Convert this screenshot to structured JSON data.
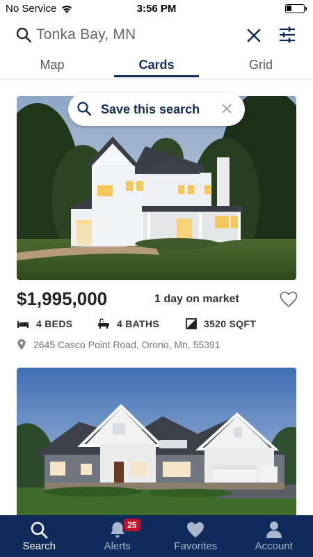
{
  "status_bar": {
    "carrier": "No Service",
    "time": "3:56 PM",
    "battery_level": 0.3,
    "wifi_icon": "wifi-icon",
    "battery_icon": "battery-icon"
  },
  "search": {
    "query": "Tonka Bay, MN",
    "search_icon": "search-icon",
    "clear_icon": "close-icon",
    "filter_icon": "filter-sliders-icon"
  },
  "tabs": [
    {
      "label": "Map",
      "active": false
    },
    {
      "label": "Cards",
      "active": true
    },
    {
      "label": "Grid",
      "active": false
    }
  ],
  "save_search": {
    "label": "Save this search",
    "icon": "search-icon",
    "dismiss_icon": "close-icon"
  },
  "listing": {
    "price": "$1,995,000",
    "days_on_market": "1 day on market",
    "beds": "4 BEDS",
    "baths": "4 BATHS",
    "sqft": "3520 SQFT",
    "address": "2645 Casco Point Road, Orono, Mn, 55391",
    "favorite_icon": "heart-outline-icon"
  },
  "bottom_nav": {
    "items": [
      {
        "label": "Search",
        "icon": "search-icon",
        "active": true
      },
      {
        "label": "Alerts",
        "icon": "bell-icon",
        "badge": "25",
        "active": false
      },
      {
        "label": "Favorites",
        "icon": "heart-icon",
        "active": false
      },
      {
        "label": "Account",
        "icon": "person-icon",
        "active": false
      }
    ]
  },
  "colors": {
    "brand_navy": "#0f2b5b",
    "badge_red": "#c8102e",
    "inactive_nav": "#a9b6cc"
  }
}
